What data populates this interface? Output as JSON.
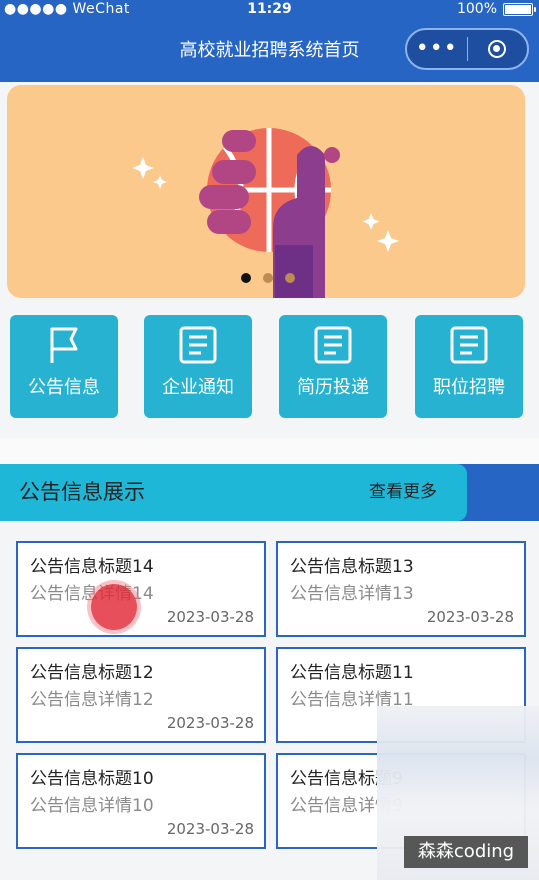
{
  "status_bar": {
    "carrier": "●●●●● WeChat",
    "time": "11:29",
    "battery": "100%"
  },
  "nav": {
    "title": "高校就业招聘系统首页",
    "more_label": "•••"
  },
  "banner": {
    "slide_count": 3,
    "active_slide": 1
  },
  "quick_entries": [
    {
      "label": "公告信息",
      "icon": "flag-icon"
    },
    {
      "label": "企业通知",
      "icon": "document-icon"
    },
    {
      "label": "简历投递",
      "icon": "document-icon"
    },
    {
      "label": "职位招聘",
      "icon": "document-icon"
    }
  ],
  "section": {
    "title": "公告信息展示",
    "more": "查看更多"
  },
  "notices": [
    {
      "title": "公告信息标题14",
      "detail": "公告信息详情14",
      "date": "2023-03-28"
    },
    {
      "title": "公告信息标题13",
      "detail": "公告信息详情13",
      "date": "2023-03-28"
    },
    {
      "title": "公告信息标题12",
      "detail": "公告信息详情12",
      "date": "2023-03-28"
    },
    {
      "title": "公告信息标题11",
      "detail": "公告信息详情11",
      "date": ""
    },
    {
      "title": "公告信息标题10",
      "detail": "公告信息详情10",
      "date": "2023-03-28"
    },
    {
      "title": "公告信息标题9",
      "detail": "公告信息详情9",
      "date": ""
    }
  ],
  "watermark": "森森coding",
  "colors": {
    "primary": "#2665c4",
    "accent": "#27b2d2",
    "banner": "#fbc98c"
  }
}
